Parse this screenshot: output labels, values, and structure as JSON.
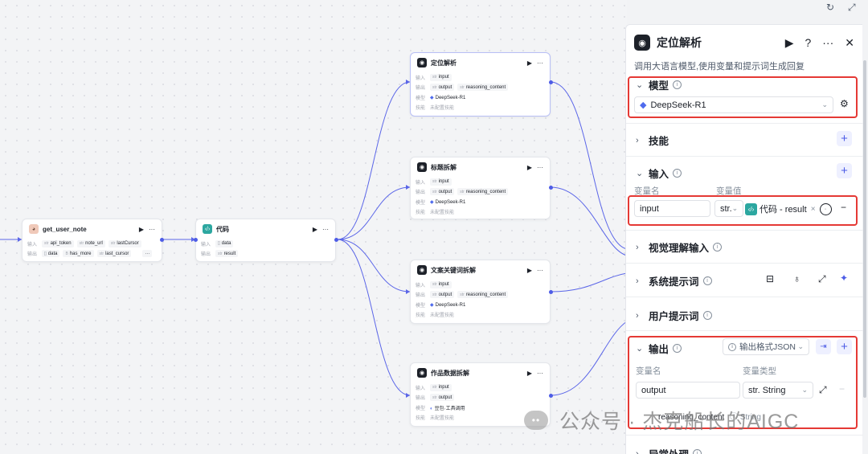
{
  "colors": {
    "accent": "#4d5ce6",
    "highlight_box": "#e53935",
    "code_tag": "#2ca7a0"
  },
  "toolbar": {
    "refresh_icon": "↻",
    "expand_icon": "⤢"
  },
  "nodes": {
    "get_user_note": {
      "title": "get_user_note",
      "inputs_label": "输入",
      "outputs_label": "输出",
      "inputs": [
        "api_token",
        "note_url",
        "lastCursor"
      ],
      "outputs": [
        "data",
        "has_more",
        "last_cursor"
      ],
      "more": "···"
    },
    "code": {
      "title": "代码",
      "inputs_label": "输入",
      "outputs_label": "输出",
      "input": "data",
      "output": "result"
    },
    "llm_nodes": [
      {
        "title": "定位解析",
        "in_label": "输入",
        "out_label": "输出",
        "model_label": "模型",
        "skill_label": "技能",
        "input": "input",
        "outputs": [
          "output",
          "reasoning_content"
        ],
        "model": "DeepSeek-R1",
        "skill": "未配置技能"
      },
      {
        "title": "标题拆解",
        "in_label": "输入",
        "out_label": "输出",
        "model_label": "模型",
        "skill_label": "技能",
        "input": "input",
        "outputs": [
          "output",
          "reasoning_content"
        ],
        "model": "DeepSeek-R1",
        "skill": "未配置技能"
      },
      {
        "title": "文案关键词拆解",
        "in_label": "输入",
        "out_label": "输出",
        "model_label": "模型",
        "skill_label": "技能",
        "input": "input",
        "outputs": [
          "output",
          "reasoning_content"
        ],
        "model": "DeepSeek-R1",
        "skill": "未配置技能"
      },
      {
        "title": "作品数据拆解",
        "in_label": "输入",
        "out_label": "输出",
        "model_label": "模型",
        "skill_label": "技能",
        "input": "input",
        "outputs": [
          "output"
        ],
        "model": "豆包·工具调用",
        "skill": "未配置技能"
      }
    ]
  },
  "panel": {
    "title": "定位解析",
    "description": "调用大语言模型,使用变量和提示词生成回复",
    "model_section": {
      "label": "模型",
      "selected": "DeepSeek-R1"
    },
    "skills_section": {
      "label": "技能"
    },
    "input_section": {
      "label": "输入",
      "col_name": "变量名",
      "col_value": "变量值",
      "var_name": "input",
      "type": "str.",
      "ref_label": "代码 - result"
    },
    "vision_section": {
      "label": "视觉理解输入"
    },
    "system_prompt_section": {
      "label": "系统提示词"
    },
    "user_prompt_section": {
      "label": "用户提示词"
    },
    "output_section": {
      "label": "输出",
      "format": "输出格式JSON",
      "col_name": "变量名",
      "col_type": "变量类型",
      "var_name": "output",
      "var_type": "str. String",
      "reasoning": "reasoning_content",
      "reasoning_type": "String"
    },
    "exception_section": {
      "label": "异常处理"
    }
  },
  "watermark": {
    "text": "公众号 · 杰克船长的AIGC"
  }
}
